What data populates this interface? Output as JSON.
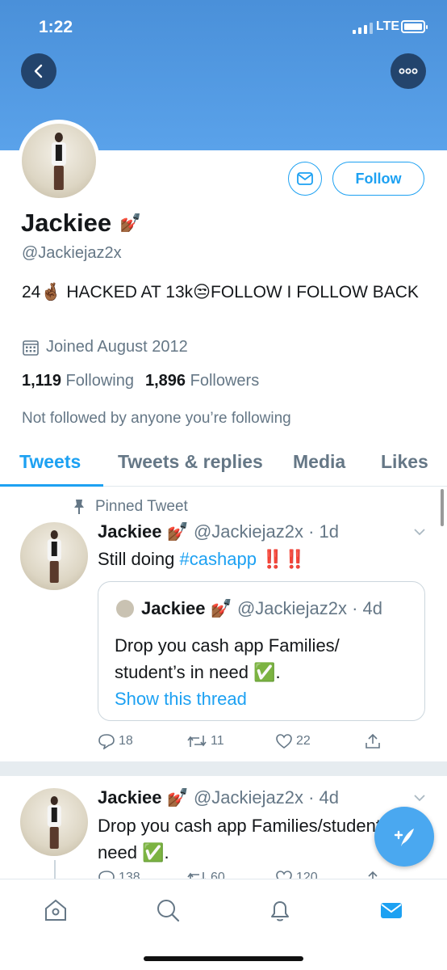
{
  "status_bar": {
    "time": "1:22",
    "network": "LTE"
  },
  "profile": {
    "display_name": "Jackiee",
    "name_emoji": "💅🏾",
    "handle": "@Jackiejaz2x",
    "bio_prefix": "24",
    "bio_emoji_1": "🤞🏾",
    "bio_middle": " HACKED AT 13k",
    "bio_emoji_2": "😒",
    "bio_suffix": "FOLLOW I FOLLOW BACK",
    "joined": "Joined August 2012",
    "following_count": "1,119",
    "following_label": "Following",
    "followers_count": "1,896",
    "followers_label": "Followers",
    "not_followed": "Not followed by anyone you’re following",
    "follow_label": "Follow"
  },
  "tabs": [
    {
      "label": "Tweets",
      "active": true
    },
    {
      "label": "Tweets & replies",
      "active": false
    },
    {
      "label": "Media",
      "active": false
    },
    {
      "label": "Likes",
      "active": false
    }
  ],
  "tweets": [
    {
      "pinned_label": "Pinned Tweet",
      "name": "Jackiee",
      "name_emoji": "💅🏾",
      "meta": "@Jackiejaz2x · 1d",
      "text_prefix": "Still doing ",
      "hashtag": "#cashapp",
      "text_suffix": " ‼️‼️",
      "quote": {
        "name": "Jackiee",
        "name_emoji": "💅🏾",
        "meta": "@Jackiejaz2x · 4d",
        "text": "Drop you cash app Families/ student’s in need ✅.",
        "link": "Show this thread"
      },
      "replies": "18",
      "retweets": "11",
      "likes": "22"
    },
    {
      "name": "Jackiee",
      "name_emoji": "💅🏾",
      "meta": "@Jackiejaz2x · 4d",
      "text": "Drop you cash app Families/student’s in need ✅.",
      "replies": "138",
      "retweets": "60",
      "likes": "120"
    }
  ],
  "colors": {
    "accent": "#1da1f2",
    "header": "#4a90d9",
    "muted": "#657786"
  },
  "icons": [
    "back-icon",
    "more-icon",
    "mail-icon",
    "calendar-icon",
    "pin-icon",
    "chevron-down-icon",
    "reply-icon",
    "retweet-icon",
    "like-icon",
    "share-icon",
    "compose-icon",
    "home-icon",
    "search-icon",
    "notifications-icon",
    "messages-icon"
  ]
}
